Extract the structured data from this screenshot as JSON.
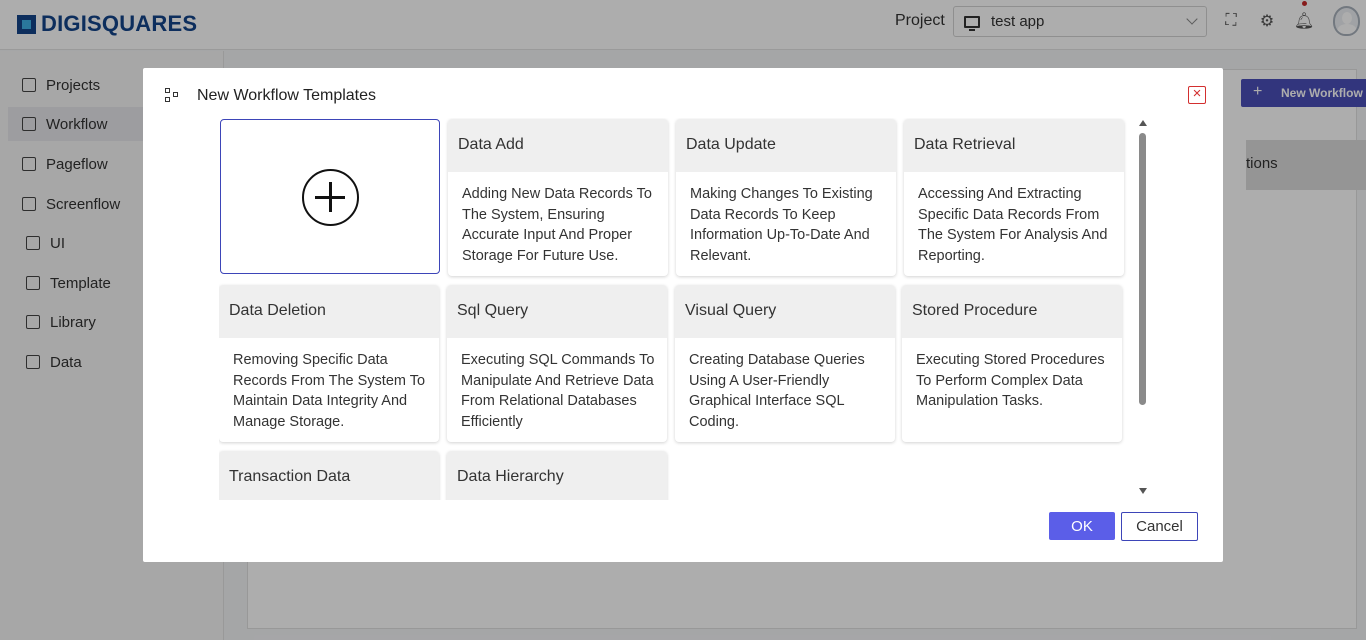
{
  "brand": {
    "name": "DIGISQUARES"
  },
  "header": {
    "project_label": "Project",
    "project_value": "test app"
  },
  "sidebar": {
    "items": [
      {
        "label": "Projects"
      },
      {
        "label": "Workflow"
      },
      {
        "label": "Pageflow"
      },
      {
        "label": "Screenflow"
      },
      {
        "label": "UI"
      },
      {
        "label": "Template"
      },
      {
        "label": "Library"
      },
      {
        "label": "Data"
      }
    ]
  },
  "background": {
    "new_workflow_label": "New Workflow",
    "column_fragment": "tions"
  },
  "modal": {
    "title": "New Workflow Templates",
    "ok_label": "OK",
    "cancel_label": "Cancel",
    "templates": [
      {
        "title": "Data Add",
        "description": "Adding New Data Records To The System, Ensuring Accurate Input And Proper Storage For Future Use."
      },
      {
        "title": "Data Update",
        "description": "Making Changes To Existing Data Records To Keep Information Up-To-Date And Relevant."
      },
      {
        "title": "Data Retrieval",
        "description": "Accessing And Extracting Specific Data Records From The System For Analysis And Reporting."
      },
      {
        "title": "Data Deletion",
        "description": "Removing Specific Data Records From The System To Maintain Data Integrity And Manage Storage."
      },
      {
        "title": "Sql Query",
        "description": "Executing SQL Commands To Manipulate And Retrieve Data From Relational Databases Efficiently"
      },
      {
        "title": "Visual Query",
        "description": "Creating Database Queries Using A User-Friendly Graphical Interface SQL Coding."
      },
      {
        "title": "Stored Procedure",
        "description": "Executing Stored Procedures To Perform Complex Data Manipulation Tasks."
      },
      {
        "title": "Transaction Data",
        "description": ""
      },
      {
        "title": "Data Hierarchy",
        "description": ""
      }
    ]
  },
  "colors": {
    "brand": "#14448a",
    "accent": "#5b5ee8",
    "danger": "#d32f2f"
  }
}
